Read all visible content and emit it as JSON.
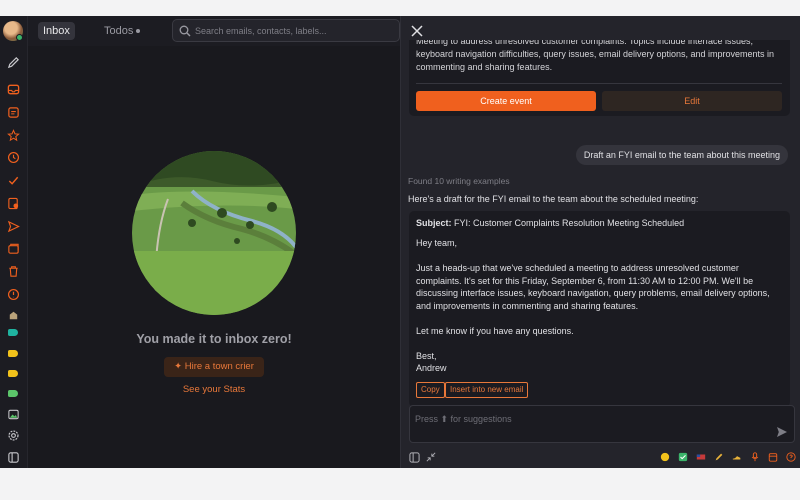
{
  "topbar": {
    "tabs": [
      {
        "label": "Inbox"
      },
      {
        "label": "Todos"
      }
    ],
    "search_placeholder": "Search emails, contacts, labels..."
  },
  "inbox": {
    "empty_title": "You made it to inbox zero!",
    "crier_button": "Hire a town crier",
    "stats_link": "See your Stats"
  },
  "assistant": {
    "event_text": "Meeting to address unresolved customer complaints. Topics include interface issues, keyboard navigation difficulties, query issues, email delivery options, and improvements in commenting and sharing features.",
    "create_event_button": "Create event",
    "edit_button": "Edit",
    "user_message": "Draft an FYI email to the team about this meeting",
    "found_examples": "Found 10 writing examples",
    "intro": "Here's a draft for the FYI email to the team about the scheduled meeting:",
    "draft": {
      "subject_label": "Subject:",
      "subject": "FYI: Customer Complaints Resolution Meeting Scheduled",
      "greeting": "Hey team,",
      "body": "Just a heads-up that we've scheduled a meeting to address unresolved customer complaints. It's set for this Friday, September 6, from 11:30 AM to 12:00 PM. We'll be discussing interface issues, keyboard navigation, query problems, email delivery options, and improvements in commenting and sharing features.",
      "closing_line": "Let me know if you have any questions.",
      "signoff": "Best,",
      "signature": "Andrew"
    },
    "copy_button": "Copy",
    "insert_button": "Insert into new email",
    "composer_placeholder": "Press ⬆ for suggestions"
  },
  "colors": {
    "accent": "#f0601e",
    "accent_text": "#e8783a",
    "tag_teal": "#1fb3a0",
    "tag_yellow": "#f2c21b",
    "tag_green": "#5cc66b"
  }
}
